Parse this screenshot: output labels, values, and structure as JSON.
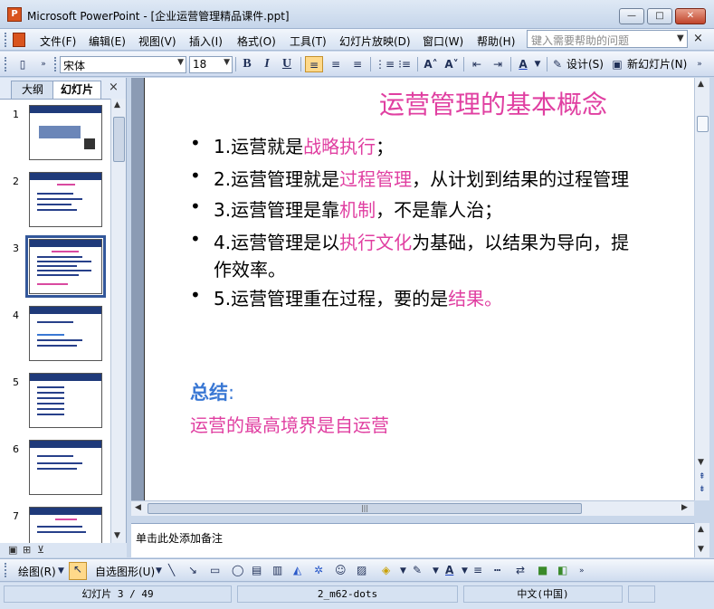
{
  "window": {
    "title": "Microsoft PowerPoint - [企业运营管理精品课件.ppt]",
    "app_icon": "powerpoint-icon",
    "minimize": "—",
    "maximize": "□",
    "close": "✕"
  },
  "menubar": {
    "items": [
      "文件(F)",
      "编辑(E)",
      "视图(V)",
      "插入(I)",
      "格式(O)",
      "工具(T)",
      "幻灯片放映(D)",
      "窗口(W)",
      "帮助(H)"
    ],
    "help_placeholder": "键入需要帮助的问题",
    "close_doc": "×"
  },
  "toolbar": {
    "font_name": "宋体",
    "font_size": "18",
    "bold": "B",
    "italic": "I",
    "underline": "U",
    "design_label": "设计(S)",
    "new_slide_label": "新幻灯片(N)"
  },
  "left_pane": {
    "tab_outline": "大纲",
    "tab_slides": "幻灯片",
    "close": "×",
    "slide_numbers": [
      "1",
      "2",
      "3",
      "4",
      "5",
      "6",
      "7"
    ],
    "selected_slide": 3
  },
  "slide": {
    "title": "运营管理的基本概念",
    "bullets": [
      {
        "lines": [
          [
            {
              "t": "1.运营就是",
              "pink": false
            },
            {
              "t": "战略执行",
              "pink": true
            },
            {
              "t": "；",
              "pink": false
            }
          ]
        ]
      },
      {
        "lines": [
          [
            {
              "t": "2.运营管理就是",
              "pink": false
            },
            {
              "t": "过程管理",
              "pink": true
            },
            {
              "t": "，从计划到结果的过程管理",
              "pink": false
            }
          ]
        ]
      },
      {
        "lines": [
          [
            {
              "t": "3.运营管理是靠",
              "pink": false
            },
            {
              "t": "机制",
              "pink": true
            },
            {
              "t": "，不是靠人治；",
              "pink": false
            }
          ]
        ]
      },
      {
        "lines": [
          [
            {
              "t": "4.运营管理是以",
              "pink": false
            },
            {
              "t": "执行文化",
              "pink": true
            },
            {
              "t": "为基础，以结果为导向，提",
              "pink": false
            }
          ],
          [
            {
              "t": "作效率。",
              "pink": false
            }
          ]
        ]
      },
      {
        "lines": [
          [
            {
              "t": "5.运营管理重在过程，要的是",
              "pink": false
            },
            {
              "t": "结果。",
              "pink": true
            }
          ]
        ]
      }
    ],
    "summary_label": "总结",
    "summary_colon": ":",
    "summary_text": "运营的最高境界是自运营"
  },
  "notes": {
    "placeholder": "单击此处添加备注"
  },
  "drawing_toolbar": {
    "draw_label": "绘图(R)",
    "autoshapes_label": "自选图形(U)"
  },
  "statusbar": {
    "slide_position": "幻灯片 3 / 49",
    "design_template": "2_m62-dots",
    "language": "中文(中国)"
  },
  "colors": {
    "accent_pink": "#e03fa1",
    "summary_blue": "#3a78d4",
    "thumb_header": "#1f3a7a"
  }
}
